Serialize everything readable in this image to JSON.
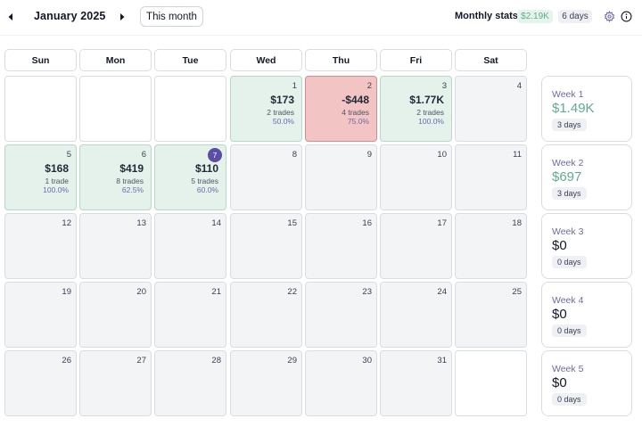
{
  "header": {
    "month": "January 2025",
    "this_month_label": "This month",
    "stats_label": "Monthly stats:",
    "stats_pnl": "$2.19K",
    "stats_days": "6 days"
  },
  "colors": {
    "win_bg": "#e4f2eb",
    "loss_bg": "#f3c4c4",
    "positive_text": "#5fae8a",
    "today_badge": "#5a4ea5"
  },
  "icons": [
    "chevron-left-icon",
    "chevron-right-icon",
    "gear-icon",
    "info-icon"
  ],
  "weekdays": [
    "Sun",
    "Mon",
    "Tue",
    "Wed",
    "Thu",
    "Fri",
    "Sat"
  ],
  "days": {
    "d1": {
      "num": "1",
      "pnl": "$173",
      "trades": "2 trades",
      "pct": "50.0%"
    },
    "d2": {
      "num": "2",
      "pnl": "-$448",
      "trades": "4 trades",
      "pct": "75.0%"
    },
    "d3": {
      "num": "3",
      "pnl": "$1.77K",
      "trades": "2 trades",
      "pct": "100.0%"
    },
    "d4": {
      "num": "4"
    },
    "d5": {
      "num": "5",
      "pnl": "$168",
      "trades": "1 trade",
      "pct": "100.0%"
    },
    "d6": {
      "num": "6",
      "pnl": "$419",
      "trades": "8 trades",
      "pct": "62.5%"
    },
    "d7": {
      "num": "7",
      "pnl": "$110",
      "trades": "5 trades",
      "pct": "60.0%"
    },
    "d8": {
      "num": "8"
    },
    "d9": {
      "num": "9"
    },
    "d10": {
      "num": "10"
    },
    "d11": {
      "num": "11"
    },
    "d12": {
      "num": "12"
    },
    "d13": {
      "num": "13"
    },
    "d14": {
      "num": "14"
    },
    "d15": {
      "num": "15"
    },
    "d16": {
      "num": "16"
    },
    "d17": {
      "num": "17"
    },
    "d18": {
      "num": "18"
    },
    "d19": {
      "num": "19"
    },
    "d20": {
      "num": "20"
    },
    "d21": {
      "num": "21"
    },
    "d22": {
      "num": "22"
    },
    "d23": {
      "num": "23"
    },
    "d24": {
      "num": "24"
    },
    "d25": {
      "num": "25"
    },
    "d26": {
      "num": "26"
    },
    "d27": {
      "num": "27"
    },
    "d28": {
      "num": "28"
    },
    "d29": {
      "num": "29"
    },
    "d30": {
      "num": "30"
    },
    "d31": {
      "num": "31"
    }
  },
  "weeks": [
    {
      "label": "Week 1",
      "value": "$1.49K",
      "days": "3 days"
    },
    {
      "label": "Week 2",
      "value": "$697",
      "days": "3 days"
    },
    {
      "label": "Week 3",
      "value": "$0",
      "days": "0 days"
    },
    {
      "label": "Week 4",
      "value": "$0",
      "days": "0 days"
    },
    {
      "label": "Week 5",
      "value": "$0",
      "days": "0 days"
    }
  ]
}
